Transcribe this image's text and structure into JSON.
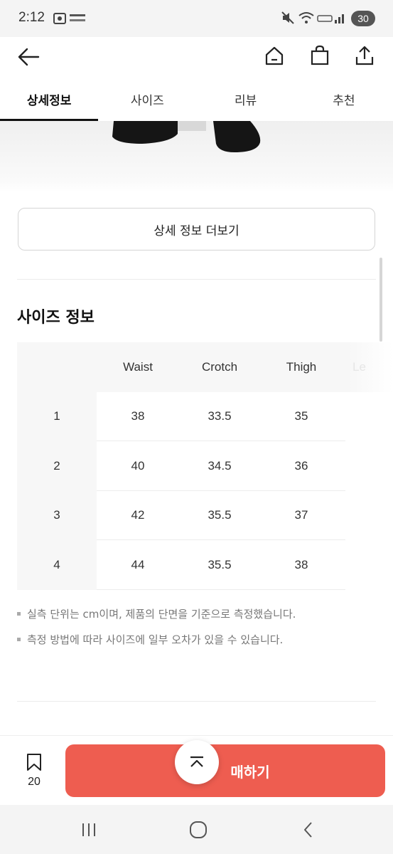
{
  "status_bar": {
    "time": "2:12",
    "battery": "30"
  },
  "header": {
    "back_icon": "arrow-left-icon",
    "home_icon": "home-icon",
    "cart_icon": "shopping-bag-icon",
    "share_icon": "share-icon"
  },
  "tabs": [
    {
      "label": "상세정보",
      "active": true
    },
    {
      "label": "사이즈",
      "active": false
    },
    {
      "label": "리뷰",
      "active": false
    },
    {
      "label": "추천",
      "active": false
    }
  ],
  "detail": {
    "more_button": "상세 정보 더보기"
  },
  "size_section": {
    "title": "사이즈 정보",
    "columns": [
      "",
      "Waist",
      "Crotch",
      "Thigh",
      "Le"
    ],
    "rows": [
      [
        "1",
        "38",
        "33.5",
        "35"
      ],
      [
        "2",
        "40",
        "34.5",
        "36"
      ],
      [
        "3",
        "42",
        "35.5",
        "37"
      ],
      [
        "4",
        "44",
        "35.5",
        "38"
      ]
    ],
    "notes": [
      "실측 단위는 cm이며, 제품의 단면을 기준으로 측정했습니다.",
      "측정 방법에 따라 사이즈에 일부 오차가 있을 수 있습니다."
    ]
  },
  "bottom_bar": {
    "like_count": "20",
    "buy_label": "구매하기",
    "buy_visible_label": "매하기"
  },
  "colors": {
    "accent": "#ee5d50",
    "text": "#222222",
    "muted": "#777777"
  }
}
